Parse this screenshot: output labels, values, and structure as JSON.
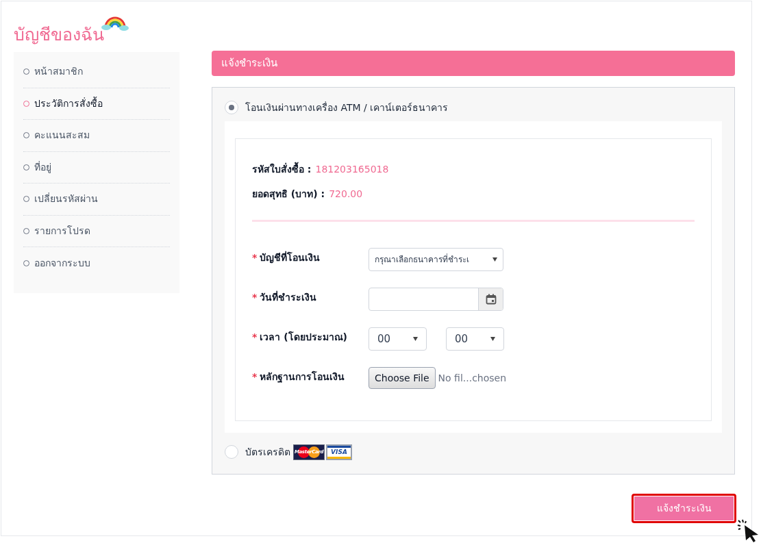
{
  "page_title": "บัญชีของฉัน",
  "sidebar": {
    "items": [
      {
        "label": "หน้าสมาชิก",
        "selected": false
      },
      {
        "label": "ประวัติการสั่งซื้อ",
        "selected": true
      },
      {
        "label": "คะแนนสะสม",
        "selected": false
      },
      {
        "label": "ที่อยู่",
        "selected": false
      },
      {
        "label": "เปลี่ยนรหัสผ่าน",
        "selected": false
      },
      {
        "label": "รายการโปรด",
        "selected": false
      },
      {
        "label": "ออกจากระบบ",
        "selected": false
      }
    ]
  },
  "header": "แจ้งชำระเงิน",
  "payment_methods": [
    {
      "kind": "transfer",
      "label": "โอนเงินผ่านทางเครื่อง ATM / เคาน์เตอร์ธนาคาร",
      "selected": true
    },
    {
      "kind": "card",
      "label": "บัตรเครดิต",
      "selected": false,
      "logos": [
        "MasterCard",
        "VISA"
      ]
    }
  ],
  "summary": [
    {
      "label": "รหัสใบสั่งซื้อ :",
      "value": "181203165018"
    },
    {
      "label": "ยอดสุทธิ (บาท) :",
      "value": "720.00"
    }
  ],
  "form": [
    {
      "kind": "select",
      "label": "บัญชีที่โอนเงิน",
      "required_mark": "*",
      "value": "กรุณาเลือกธนาคารที่ชำระเ"
    },
    {
      "kind": "date",
      "label": "วันที่ชำระเงิน",
      "required_mark": "*"
    },
    {
      "kind": "time",
      "label": "เวลา (โดยประมาณ)",
      "required_mark": "*",
      "hour": "00",
      "minute": "00"
    },
    {
      "kind": "file",
      "label": "หลักฐานการโอนเงิน",
      "required_mark": "*",
      "button": "Choose File",
      "status": "No fil...chosen"
    }
  ],
  "submit": "แจ้งชำระเงิน"
}
